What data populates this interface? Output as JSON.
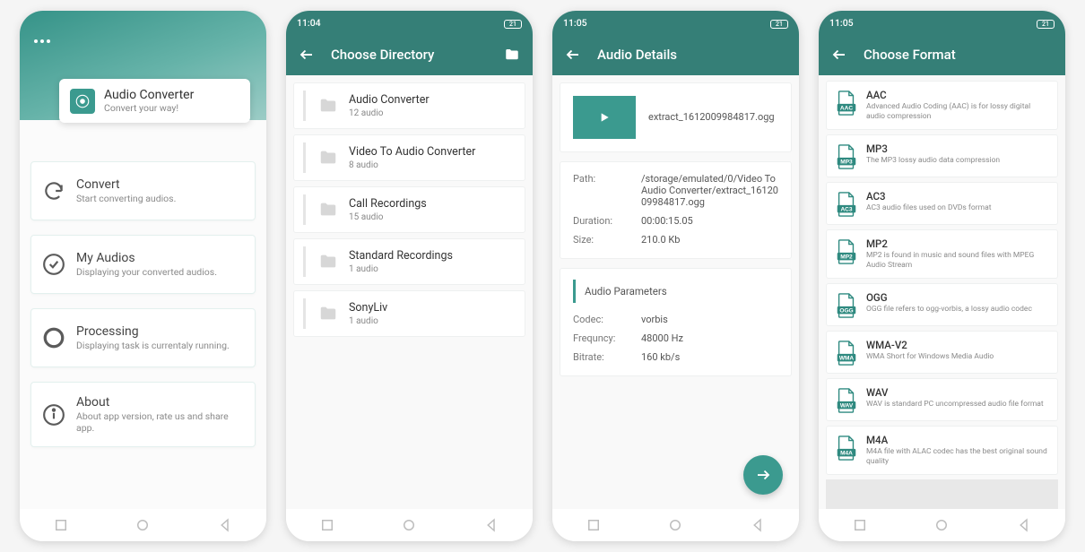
{
  "status": {
    "time_a": "11:04",
    "time_b": "11:05",
    "battery": "21"
  },
  "screen1": {
    "app_title": "Audio Converter",
    "app_subtitle": "Convert your way!",
    "menu": [
      {
        "title": "Convert",
        "sub": "Start converting audios."
      },
      {
        "title": "My Audios",
        "sub": "Displaying your converted audios."
      },
      {
        "title": "Processing",
        "sub": "Displaying task is currentaly running."
      },
      {
        "title": "About",
        "sub": "About app version, rate us and share app."
      }
    ]
  },
  "screen2": {
    "title": "Choose Directory",
    "dirs": [
      {
        "name": "Audio Converter",
        "count": "12 audio"
      },
      {
        "name": "Video To Audio Converter",
        "count": "8 audio"
      },
      {
        "name": "Call Recordings",
        "count": "15 audio"
      },
      {
        "name": "Standard Recordings",
        "count": "1 audio"
      },
      {
        "name": "SonyLiv",
        "count": "1 audio"
      }
    ]
  },
  "screen3": {
    "title": "Audio Details",
    "filename": "extract_1612009984817.ogg",
    "path_k": "Path:",
    "path_v": "/storage/emulated/0/Video To Audio Converter/extract_1612009984817.ogg",
    "duration_k": "Duration:",
    "duration_v": "00:00:15.05",
    "size_k": "Size:",
    "size_v": "210.0 Kb",
    "params_head": "Audio Parameters",
    "codec_k": "Codec:",
    "codec_v": "vorbis",
    "freq_k": "Frequncy:",
    "freq_v": "48000   Hz",
    "bitrate_k": "Bitrate:",
    "bitrate_v": "160   kb/s"
  },
  "screen4": {
    "title": "Choose Format",
    "formats": [
      {
        "tag": "AAC",
        "name": "AAC",
        "desc": "Advanced Audio Coding (AAC) is for lossy digital audio compression"
      },
      {
        "tag": "MP3",
        "name": "MP3",
        "desc": "The MP3 lossy audio data compression"
      },
      {
        "tag": "AC3",
        "name": "AC3",
        "desc": "AC3 audio files used on DVDs format"
      },
      {
        "tag": "MP2",
        "name": "MP2",
        "desc": "MP2 is found in music and sound files with MPEG Audio Stream"
      },
      {
        "tag": "OGG",
        "name": "OGG",
        "desc": "OGG file refers to ogg-vorbis, a lossy audio codec"
      },
      {
        "tag": "WMA",
        "name": "WMA-V2",
        "desc": "WMA Short for Windows Media Audio"
      },
      {
        "tag": "WAV",
        "name": "WAV",
        "desc": "WAV is standard PC uncompressed audio file format"
      },
      {
        "tag": "M4A",
        "name": "M4A",
        "desc": "M4A file with ALAC codec has the best original sound quality"
      }
    ]
  }
}
